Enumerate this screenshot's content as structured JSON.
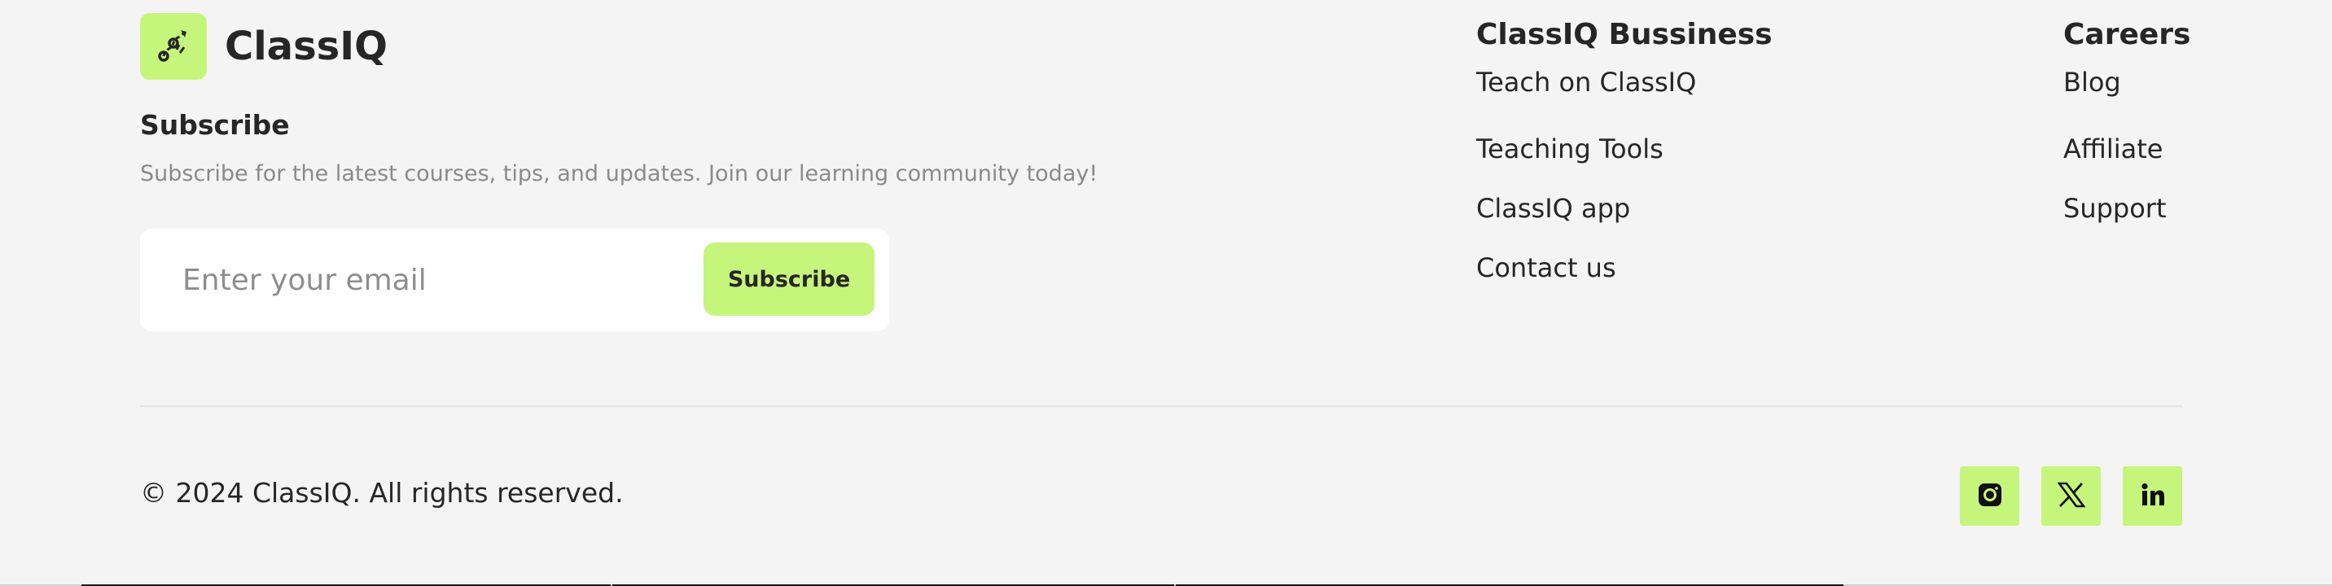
{
  "brand": {
    "name": "ClassIQ",
    "logo_icon": "graduation-path-icon",
    "accent_color": "#c6f57c"
  },
  "subscribe": {
    "title": "Subscribe",
    "description": "Subscribe for the latest courses, tips, and updates. Join our learning community today!",
    "email_placeholder": "Enter your email",
    "email_value": "",
    "button_label": "Subscribe"
  },
  "columns": [
    {
      "title": "ClassIQ Bussiness",
      "links": [
        "Teach on ClassIQ",
        "Teaching Tools",
        "ClassIQ app",
        "Contact us"
      ]
    },
    {
      "title": "Careers",
      "links": [
        "Blog",
        "Affiliate",
        "Support"
      ]
    }
  ],
  "footer": {
    "copyright": "© 2024 ClassIQ. All rights reserved.",
    "socials": [
      {
        "name": "Instagram",
        "icon": "instagram-icon"
      },
      {
        "name": "X",
        "icon": "x-icon"
      },
      {
        "name": "LinkedIn",
        "icon": "linkedin-icon"
      }
    ]
  }
}
